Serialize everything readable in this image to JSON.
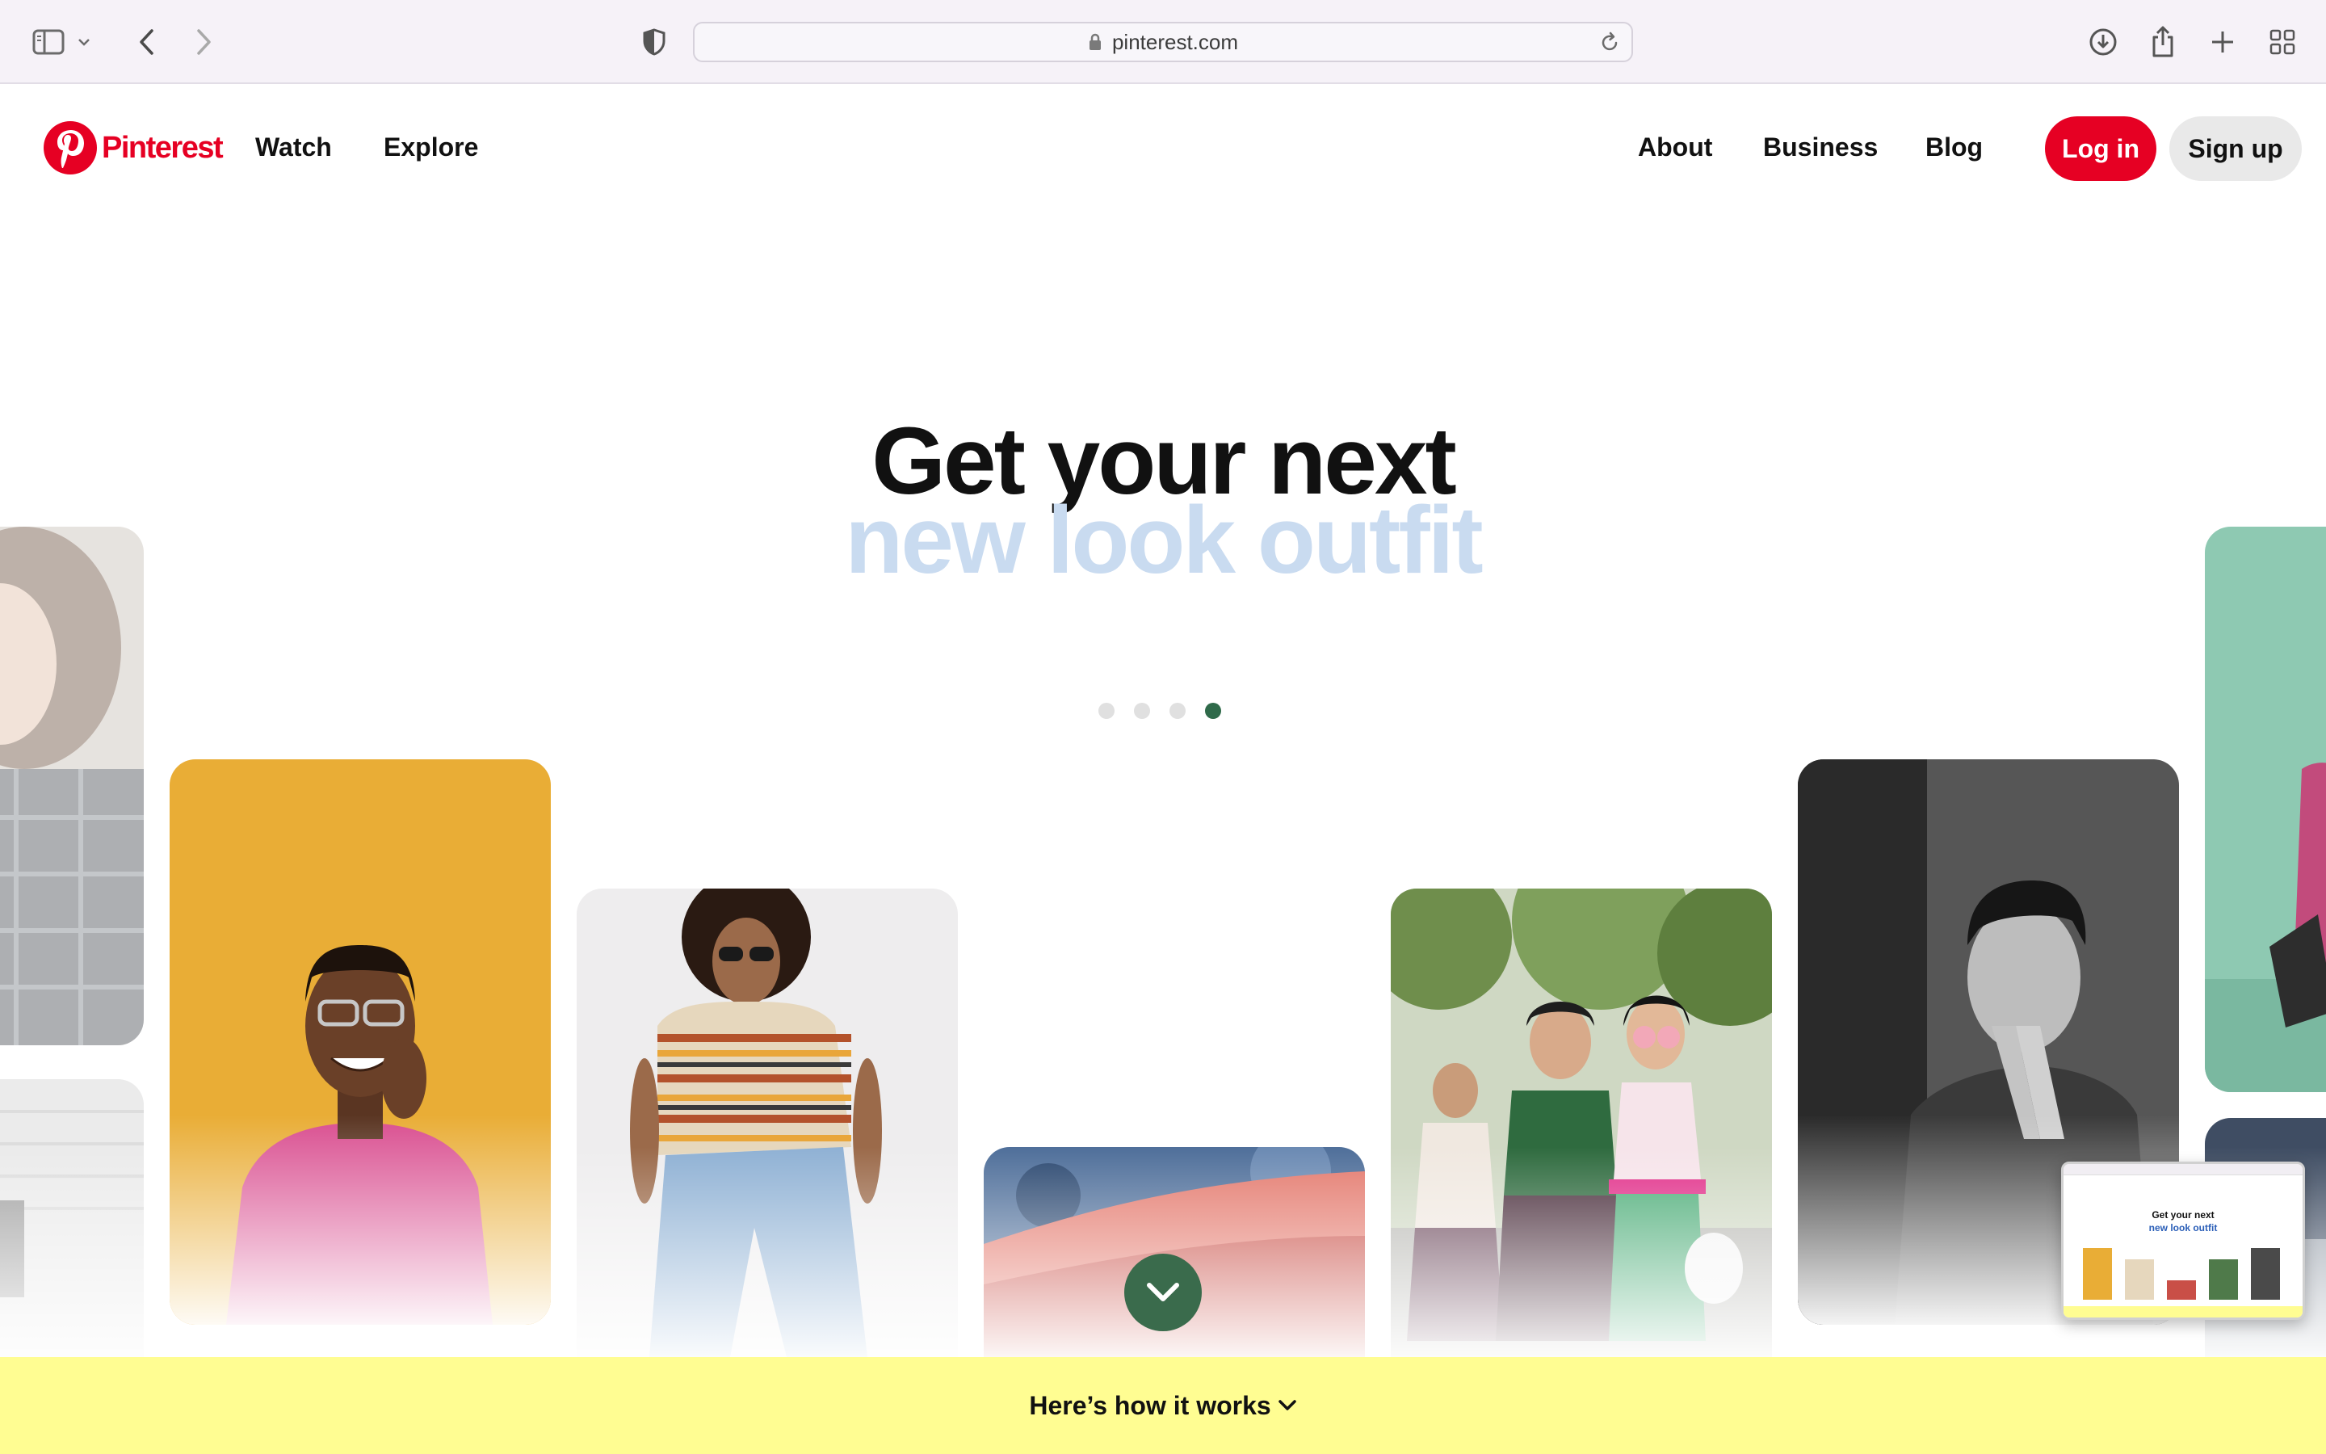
{
  "browser": {
    "url": "pinterest.com"
  },
  "header": {
    "logo_text": "Pinterest",
    "nav_left": [
      "Watch",
      "Explore"
    ],
    "nav_right": [
      "About",
      "Business",
      "Blog"
    ],
    "login_label": "Log in",
    "signup_label": "Sign up"
  },
  "hero": {
    "headline": "Get your next",
    "subline": "new look outfit",
    "carousel_total": 4,
    "carousel_active": 4
  },
  "banner": {
    "label": "Here’s how it works"
  },
  "thumbnail": {
    "headline": "Get your next",
    "subline": "new look outfit"
  },
  "colors": {
    "brand_red": "#e60023",
    "subline_tint": "#c9dbf0",
    "active_dot": "#2f6a4a",
    "banner_yellow": "#fffd92"
  }
}
